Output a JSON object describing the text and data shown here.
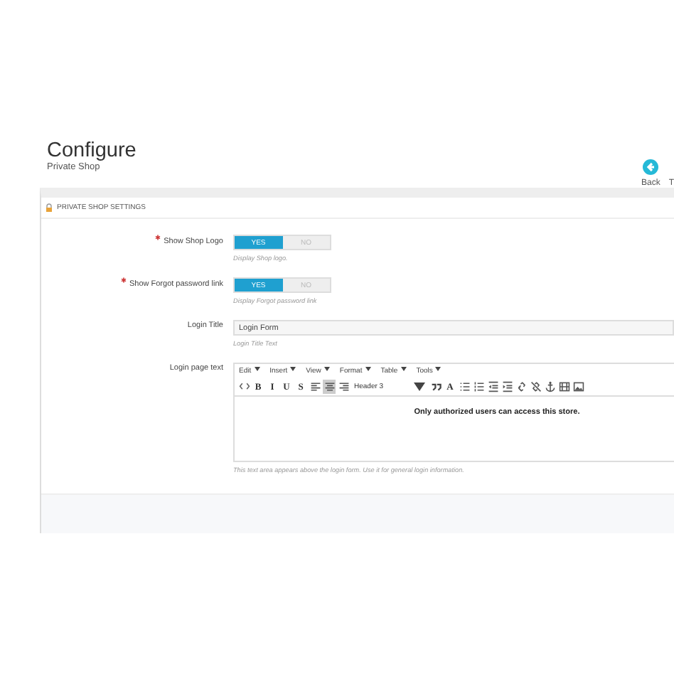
{
  "header": {
    "title": "Configure",
    "subtitle": "Private Shop",
    "back_label": "Back",
    "cut_label": "T"
  },
  "panel": {
    "heading": "PRIVATE SHOP SETTINGS",
    "fields": [
      {
        "kind": "switch",
        "label": "Show Shop Logo",
        "required": true,
        "yes": "YES",
        "no": "NO",
        "on": true,
        "help": "Display Shop logo."
      },
      {
        "kind": "switch",
        "label": "Show Forgot password link",
        "required": true,
        "yes": "YES",
        "no": "NO",
        "on": true,
        "help": "Display Forgot password link"
      },
      {
        "kind": "text",
        "label": "Login Title",
        "required": false,
        "value": "Login Form",
        "help": "Login Title Text"
      },
      {
        "kind": "editor",
        "label": "Login page text",
        "required": false,
        "content": "Only authorized users can access this store.",
        "help": "This text area appears above the login form. Use it for general login information.",
        "menus": [
          "Edit",
          "Insert",
          "View",
          "Format",
          "Table",
          "Tools"
        ],
        "toolbar": [
          {
            "kind": "code",
            "selected": false
          },
          {
            "kind": "letter",
            "label": "B",
            "selected": false
          },
          {
            "kind": "letter",
            "label": "I",
            "selected": false
          },
          {
            "kind": "letter",
            "label": "U",
            "selected": false
          },
          {
            "kind": "letter",
            "label": "S",
            "selected": false
          },
          {
            "kind": "align-left",
            "selected": false
          },
          {
            "kind": "align-center",
            "selected": true
          },
          {
            "kind": "align-right",
            "selected": false
          },
          {
            "kind": "dropdown",
            "label": "Header 3",
            "selected": false
          },
          {
            "kind": "quote",
            "selected": false
          },
          {
            "kind": "letter",
            "label": "A",
            "selected": false
          },
          {
            "kind": "bullets",
            "selected": false
          },
          {
            "kind": "numbers",
            "selected": false
          },
          {
            "kind": "outdent",
            "selected": false
          },
          {
            "kind": "indent",
            "selected": false
          },
          {
            "kind": "link",
            "selected": false
          },
          {
            "kind": "unlink",
            "selected": false
          },
          {
            "kind": "anchor",
            "selected": false
          },
          {
            "kind": "media",
            "selected": false
          },
          {
            "kind": "image",
            "selected": false
          }
        ]
      }
    ]
  }
}
